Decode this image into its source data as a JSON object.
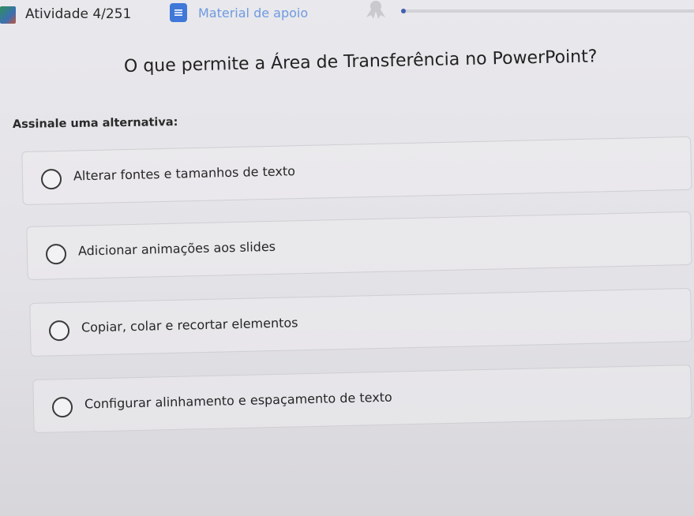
{
  "header": {
    "activity_counter": "Atividade 4/251",
    "support_link_label": "Material de apoio",
    "progress_fraction": 0.0
  },
  "question": {
    "text": "O que permite a Área de Transferência no PowerPoint?",
    "instruction": "Assinale uma alternativa:",
    "options": [
      {
        "label": "Alterar fontes e tamanhos de texto"
      },
      {
        "label": "Adicionar animações aos slides"
      },
      {
        "label": "Copiar, colar e recortar elementos"
      },
      {
        "label": "Configurar alinhamento e espaçamento de texto"
      }
    ]
  },
  "icons": {
    "logo": "app-logo-icon",
    "support": "document-icon",
    "badge": "ribbon-badge-icon"
  },
  "colors": {
    "accent": "#3f78d8",
    "link": "#6e9be0",
    "progress": "#3f5fb0"
  }
}
